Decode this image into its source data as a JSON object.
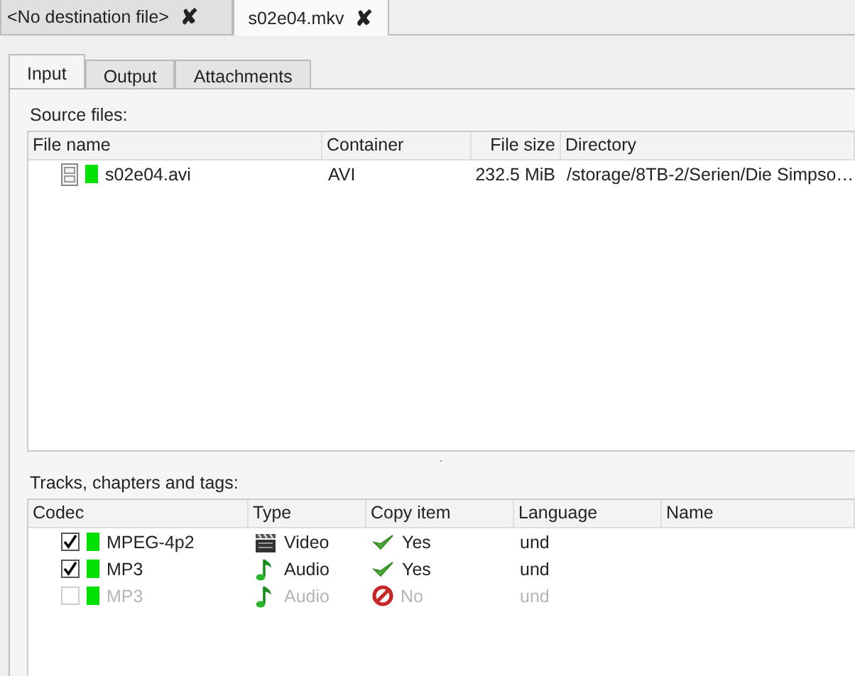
{
  "file_tabs": [
    {
      "label": "<No destination file>",
      "selected": false,
      "close": "✘"
    },
    {
      "label": "s02e04.mkv",
      "selected": true,
      "close": "✘"
    }
  ],
  "tabs": [
    {
      "label": "Input",
      "selected": true
    },
    {
      "label": "Output",
      "selected": false
    },
    {
      "label": "Attachments",
      "selected": false
    }
  ],
  "source_files": {
    "label": "Source files:",
    "columns": [
      "File name",
      "Container",
      "File size",
      "Directory"
    ],
    "rows": [
      {
        "file_name": "s02e04.avi",
        "container": "AVI",
        "file_size": "232.5 MiB",
        "directory": "/storage/8TB-2/Serien/Die Simpso…"
      }
    ]
  },
  "tracks": {
    "label": "Tracks, chapters and tags:",
    "columns": [
      "Codec",
      "Type",
      "Copy item",
      "Language",
      "Name"
    ],
    "rows": [
      {
        "checked": true,
        "enabled": true,
        "codec": "MPEG-4p2",
        "kind": "video",
        "type": "Video",
        "copy": true,
        "copy_item": "Yes",
        "language": "und"
      },
      {
        "checked": true,
        "enabled": true,
        "codec": "MP3",
        "kind": "audio",
        "type": "Audio",
        "copy": true,
        "copy_item": "Yes",
        "language": "und"
      },
      {
        "checked": false,
        "enabled": false,
        "codec": "MP3",
        "kind": "audio",
        "type": "Audio",
        "copy": false,
        "copy_item": "No",
        "language": "und"
      }
    ]
  }
}
